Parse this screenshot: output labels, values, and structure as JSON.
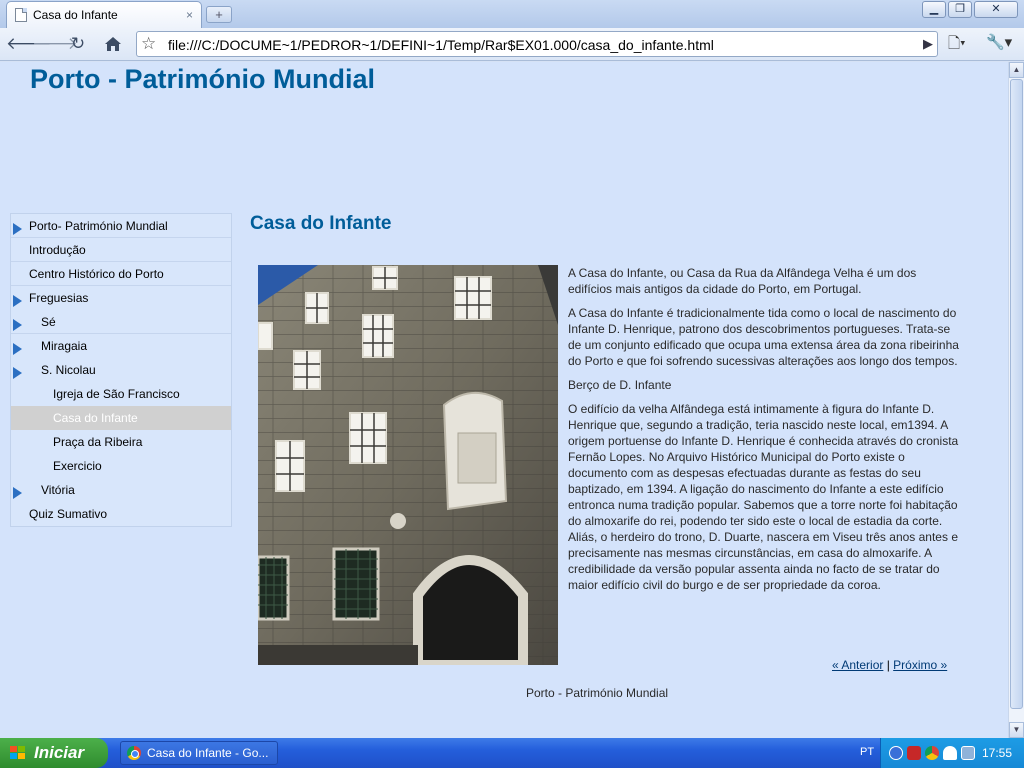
{
  "browser": {
    "tab_title": "Casa do Infante",
    "tab_close": "×",
    "new_tab": "+",
    "url": "file:///C:/DOCUME~1/PEDROR~1/DEFINI~1/Temp/Rar$EX01.000/casa_do_infante.html",
    "back_icon": "arrow-left-icon",
    "forward_icon": "arrow-right-icon",
    "reload_icon": "reload-icon",
    "home_icon": "home-icon",
    "star_icon": "star-icon",
    "go_icon": "play-icon",
    "page_menu_icon": "page-icon",
    "wrench_icon": "wrench-icon"
  },
  "site": {
    "title": "Porto - Património Mundial"
  },
  "nav": {
    "items": [
      {
        "label": "Porto- Património Mundial",
        "level": 0,
        "arrow": true,
        "active": false
      },
      {
        "label": "Introdução",
        "level": 0,
        "arrow": false,
        "active": false
      },
      {
        "label": "Centro Histórico do Porto",
        "level": 0,
        "arrow": false,
        "active": false
      },
      {
        "label": "Freguesias",
        "level": 0,
        "arrow": true,
        "active": false
      },
      {
        "label": "Sé",
        "level": 1,
        "arrow": true,
        "active": false
      },
      {
        "label": "Miragaia",
        "level": 1,
        "arrow": true,
        "active": false
      },
      {
        "label": "S. Nicolau",
        "level": 1,
        "arrow": true,
        "active": false
      },
      {
        "label": "Igreja de São Francisco",
        "level": 2,
        "arrow": false,
        "active": false
      },
      {
        "label": "Casa do Infante",
        "level": 2,
        "arrow": false,
        "active": true
      },
      {
        "label": "Praça da Ribeira",
        "level": 2,
        "arrow": false,
        "active": false
      },
      {
        "label": "Exercicio",
        "level": 2,
        "arrow": false,
        "active": false
      },
      {
        "label": "Vitória",
        "level": 1,
        "arrow": true,
        "active": false
      },
      {
        "label": "Quiz Sumativo",
        "level": 0,
        "arrow": false,
        "active": false
      }
    ]
  },
  "content": {
    "heading": "Casa do Infante",
    "paragraphs": [
      "A Casa do Infante, ou Casa da Rua da Alfândega Velha é um dos edifícios mais antigos da cidade do Porto, em Portugal.",
      "A Casa do Infante é tradicionalmente tida como o local de nascimento do Infante D. Henrique, patrono dos descobrimentos portugueses. Trata-se de um conjunto edificado que ocupa uma extensa área da zona ribeirinha do Porto e que foi sofrendo sucessivas alterações aos longo dos tempos.",
      "Berço de D. Infante",
      "O edifício da velha Alfândega está intimamente à figura do Infante D. Henrique que, segundo a tradição, teria nascido neste local, em1394. A origem portuense do Infante D. Henrique é conhecida através do cronista Fernão Lopes. No Arquivo Histórico Municipal do Porto existe o documento com as despesas efectuadas durante as festas do seu baptizado, em 1394. A ligação do nascimento do Infante a este edifício entronca numa tradição popular. Sabemos que a torre norte foi habitação do almoxarife do rei, podendo ter sido este o local de estadia da corte. Aliás, o herdeiro do trono, D. Duarte, nascera em Viseu três anos antes e precisamente nas mesmas circunstâncias, em casa do almoxarife. A credibilidade da versão popular assenta ainda no facto de se tratar do maior edifício civil do burgo e de ser propriedade da coroa."
    ],
    "prev_label": "« Anterior",
    "separator": " | ",
    "next_label": "Próximo »",
    "footer": "Porto - Património Mundial"
  },
  "taskbar": {
    "start_label": "Iniciar",
    "window_item": "Casa do Infante - Go...",
    "language": "PT",
    "clock": "17:55"
  },
  "colors": {
    "heading": "#005d99",
    "page_bg": "#d4e3fb",
    "active_nav": "#d0d0d0",
    "nav_arrow": "#2b6fc2"
  }
}
